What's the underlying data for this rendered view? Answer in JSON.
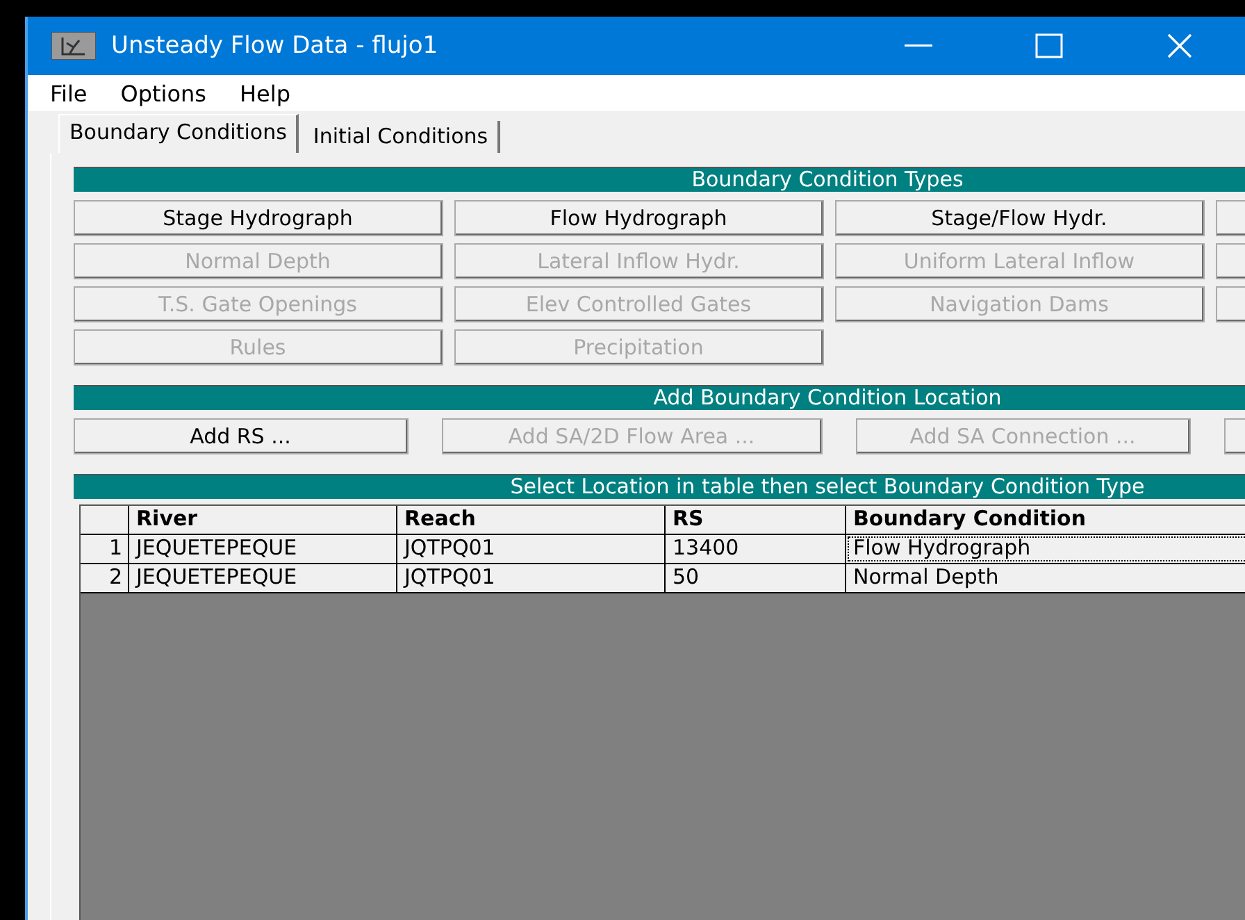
{
  "window": {
    "title": "Unsteady Flow Data - flujo1"
  },
  "menu": [
    "File",
    "Options",
    "Help"
  ],
  "tabs": [
    {
      "label": "Boundary Conditions",
      "selected": true
    },
    {
      "label": "Initial Conditions",
      "selected": false
    }
  ],
  "boundary_condition_types": {
    "title": "Boundary Condition Types",
    "buttons": [
      {
        "kind": "full",
        "label": "Stage Hydrograph",
        "disabled": false
      },
      {
        "kind": "full",
        "label": "Flow Hydrograph",
        "disabled": false
      },
      {
        "kind": "full",
        "label": "Stage/Flow Hydr.",
        "disabled": false
      },
      {
        "kind": "cut"
      },
      {
        "kind": "full",
        "label": "Normal Depth",
        "disabled": true
      },
      {
        "kind": "full",
        "label": "Lateral Inflow Hydr.",
        "disabled": true
      },
      {
        "kind": "full",
        "label": "Uniform Lateral Inflow",
        "disabled": true
      },
      {
        "kind": "cut"
      },
      {
        "kind": "full",
        "label": "T.S. Gate Openings",
        "disabled": true
      },
      {
        "kind": "full",
        "label": "Elev Controlled Gates",
        "disabled": true
      },
      {
        "kind": "full",
        "label": "Navigation Dams",
        "disabled": true
      },
      {
        "kind": "cut"
      },
      {
        "kind": "full",
        "label": "Rules",
        "disabled": true
      },
      {
        "kind": "full",
        "label": "Precipitation",
        "disabled": true
      }
    ]
  },
  "add_location": {
    "title": "Add Boundary Condition Location",
    "buttons": [
      {
        "kind": "full",
        "label": "Add RS ...",
        "disabled": false
      },
      {
        "kind": "full",
        "label": "Add SA/2D Flow Area ...",
        "disabled": true
      },
      {
        "kind": "full",
        "label": "Add SA Connection ...",
        "disabled": true
      },
      {
        "kind": "cut"
      }
    ]
  },
  "table": {
    "title": "Select Location in table then select Boundary Condition Type",
    "columns": [
      "River",
      "Reach",
      "RS",
      "Boundary Condition"
    ],
    "rows": [
      {
        "number": "1",
        "cells": [
          "JEQUETEPEQUE",
          "JQTPQ01",
          "13400",
          "Flow Hydrograph"
        ],
        "focused": true
      },
      {
        "number": "2",
        "cells": [
          "JEQUETEPEQUE",
          "JQTPQ01",
          "50",
          "Normal Depth"
        ],
        "focused": false
      }
    ]
  }
}
